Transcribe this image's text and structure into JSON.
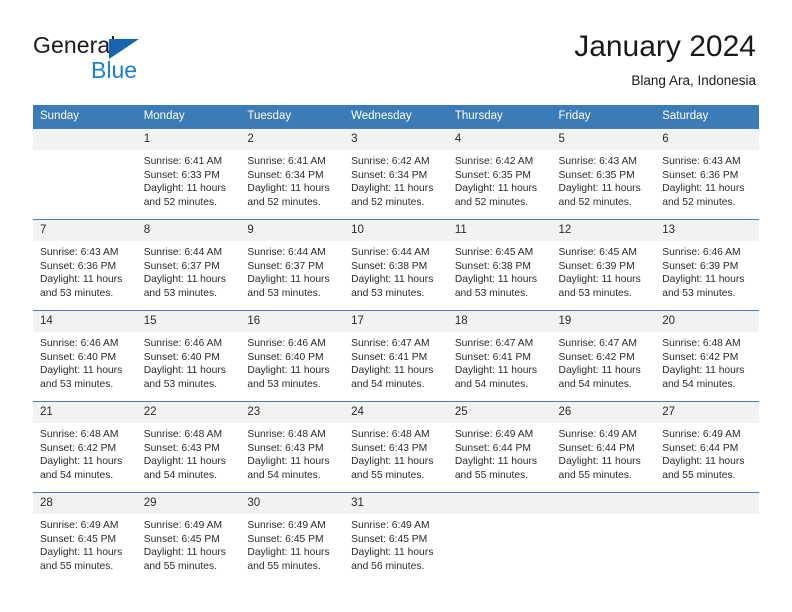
{
  "brand": {
    "name_part1": "General",
    "name_part2": "Blue",
    "accent_color": "#1a7fd4",
    "triangle_color": "#1565b0",
    "triangle_icon": "triangle-right-icon"
  },
  "header": {
    "title": "January 2024",
    "subtitle": "Blang Ara, Indonesia",
    "header_bg_color": "#3b7cb8"
  },
  "calendar": {
    "weekday_headers": [
      "Sunday",
      "Monday",
      "Tuesday",
      "Wednesday",
      "Thursday",
      "Friday",
      "Saturday"
    ],
    "labels": {
      "sunrise": "Sunrise:",
      "sunset": "Sunset:",
      "daylight": "Daylight:"
    },
    "weeks": [
      [
        {
          "day": "",
          "sunrise": "",
          "sunset": "",
          "daylight_line1": "",
          "daylight_line2": "",
          "empty": true
        },
        {
          "day": "1",
          "sunrise": "Sunrise: 6:41 AM",
          "sunset": "Sunset: 6:33 PM",
          "daylight_line1": "Daylight: 11 hours",
          "daylight_line2": "and 52 minutes.",
          "empty": false
        },
        {
          "day": "2",
          "sunrise": "Sunrise: 6:41 AM",
          "sunset": "Sunset: 6:34 PM",
          "daylight_line1": "Daylight: 11 hours",
          "daylight_line2": "and 52 minutes.",
          "empty": false
        },
        {
          "day": "3",
          "sunrise": "Sunrise: 6:42 AM",
          "sunset": "Sunset: 6:34 PM",
          "daylight_line1": "Daylight: 11 hours",
          "daylight_line2": "and 52 minutes.",
          "empty": false
        },
        {
          "day": "4",
          "sunrise": "Sunrise: 6:42 AM",
          "sunset": "Sunset: 6:35 PM",
          "daylight_line1": "Daylight: 11 hours",
          "daylight_line2": "and 52 minutes.",
          "empty": false
        },
        {
          "day": "5",
          "sunrise": "Sunrise: 6:43 AM",
          "sunset": "Sunset: 6:35 PM",
          "daylight_line1": "Daylight: 11 hours",
          "daylight_line2": "and 52 minutes.",
          "empty": false
        },
        {
          "day": "6",
          "sunrise": "Sunrise: 6:43 AM",
          "sunset": "Sunset: 6:36 PM",
          "daylight_line1": "Daylight: 11 hours",
          "daylight_line2": "and 52 minutes.",
          "empty": false
        }
      ],
      [
        {
          "day": "7",
          "sunrise": "Sunrise: 6:43 AM",
          "sunset": "Sunset: 6:36 PM",
          "daylight_line1": "Daylight: 11 hours",
          "daylight_line2": "and 53 minutes.",
          "empty": false
        },
        {
          "day": "8",
          "sunrise": "Sunrise: 6:44 AM",
          "sunset": "Sunset: 6:37 PM",
          "daylight_line1": "Daylight: 11 hours",
          "daylight_line2": "and 53 minutes.",
          "empty": false
        },
        {
          "day": "9",
          "sunrise": "Sunrise: 6:44 AM",
          "sunset": "Sunset: 6:37 PM",
          "daylight_line1": "Daylight: 11 hours",
          "daylight_line2": "and 53 minutes.",
          "empty": false
        },
        {
          "day": "10",
          "sunrise": "Sunrise: 6:44 AM",
          "sunset": "Sunset: 6:38 PM",
          "daylight_line1": "Daylight: 11 hours",
          "daylight_line2": "and 53 minutes.",
          "empty": false
        },
        {
          "day": "11",
          "sunrise": "Sunrise: 6:45 AM",
          "sunset": "Sunset: 6:38 PM",
          "daylight_line1": "Daylight: 11 hours",
          "daylight_line2": "and 53 minutes.",
          "empty": false
        },
        {
          "day": "12",
          "sunrise": "Sunrise: 6:45 AM",
          "sunset": "Sunset: 6:39 PM",
          "daylight_line1": "Daylight: 11 hours",
          "daylight_line2": "and 53 minutes.",
          "empty": false
        },
        {
          "day": "13",
          "sunrise": "Sunrise: 6:46 AM",
          "sunset": "Sunset: 6:39 PM",
          "daylight_line1": "Daylight: 11 hours",
          "daylight_line2": "and 53 minutes.",
          "empty": false
        }
      ],
      [
        {
          "day": "14",
          "sunrise": "Sunrise: 6:46 AM",
          "sunset": "Sunset: 6:40 PM",
          "daylight_line1": "Daylight: 11 hours",
          "daylight_line2": "and 53 minutes.",
          "empty": false
        },
        {
          "day": "15",
          "sunrise": "Sunrise: 6:46 AM",
          "sunset": "Sunset: 6:40 PM",
          "daylight_line1": "Daylight: 11 hours",
          "daylight_line2": "and 53 minutes.",
          "empty": false
        },
        {
          "day": "16",
          "sunrise": "Sunrise: 6:46 AM",
          "sunset": "Sunset: 6:40 PM",
          "daylight_line1": "Daylight: 11 hours",
          "daylight_line2": "and 53 minutes.",
          "empty": false
        },
        {
          "day": "17",
          "sunrise": "Sunrise: 6:47 AM",
          "sunset": "Sunset: 6:41 PM",
          "daylight_line1": "Daylight: 11 hours",
          "daylight_line2": "and 54 minutes.",
          "empty": false
        },
        {
          "day": "18",
          "sunrise": "Sunrise: 6:47 AM",
          "sunset": "Sunset: 6:41 PM",
          "daylight_line1": "Daylight: 11 hours",
          "daylight_line2": "and 54 minutes.",
          "empty": false
        },
        {
          "day": "19",
          "sunrise": "Sunrise: 6:47 AM",
          "sunset": "Sunset: 6:42 PM",
          "daylight_line1": "Daylight: 11 hours",
          "daylight_line2": "and 54 minutes.",
          "empty": false
        },
        {
          "day": "20",
          "sunrise": "Sunrise: 6:48 AM",
          "sunset": "Sunset: 6:42 PM",
          "daylight_line1": "Daylight: 11 hours",
          "daylight_line2": "and 54 minutes.",
          "empty": false
        }
      ],
      [
        {
          "day": "21",
          "sunrise": "Sunrise: 6:48 AM",
          "sunset": "Sunset: 6:42 PM",
          "daylight_line1": "Daylight: 11 hours",
          "daylight_line2": "and 54 minutes.",
          "empty": false
        },
        {
          "day": "22",
          "sunrise": "Sunrise: 6:48 AM",
          "sunset": "Sunset: 6:43 PM",
          "daylight_line1": "Daylight: 11 hours",
          "daylight_line2": "and 54 minutes.",
          "empty": false
        },
        {
          "day": "23",
          "sunrise": "Sunrise: 6:48 AM",
          "sunset": "Sunset: 6:43 PM",
          "daylight_line1": "Daylight: 11 hours",
          "daylight_line2": "and 54 minutes.",
          "empty": false
        },
        {
          "day": "24",
          "sunrise": "Sunrise: 6:48 AM",
          "sunset": "Sunset: 6:43 PM",
          "daylight_line1": "Daylight: 11 hours",
          "daylight_line2": "and 55 minutes.",
          "empty": false
        },
        {
          "day": "25",
          "sunrise": "Sunrise: 6:49 AM",
          "sunset": "Sunset: 6:44 PM",
          "daylight_line1": "Daylight: 11 hours",
          "daylight_line2": "and 55 minutes.",
          "empty": false
        },
        {
          "day": "26",
          "sunrise": "Sunrise: 6:49 AM",
          "sunset": "Sunset: 6:44 PM",
          "daylight_line1": "Daylight: 11 hours",
          "daylight_line2": "and 55 minutes.",
          "empty": false
        },
        {
          "day": "27",
          "sunrise": "Sunrise: 6:49 AM",
          "sunset": "Sunset: 6:44 PM",
          "daylight_line1": "Daylight: 11 hours",
          "daylight_line2": "and 55 minutes.",
          "empty": false
        }
      ],
      [
        {
          "day": "28",
          "sunrise": "Sunrise: 6:49 AM",
          "sunset": "Sunset: 6:45 PM",
          "daylight_line1": "Daylight: 11 hours",
          "daylight_line2": "and 55 minutes.",
          "empty": false
        },
        {
          "day": "29",
          "sunrise": "Sunrise: 6:49 AM",
          "sunset": "Sunset: 6:45 PM",
          "daylight_line1": "Daylight: 11 hours",
          "daylight_line2": "and 55 minutes.",
          "empty": false
        },
        {
          "day": "30",
          "sunrise": "Sunrise: 6:49 AM",
          "sunset": "Sunset: 6:45 PM",
          "daylight_line1": "Daylight: 11 hours",
          "daylight_line2": "and 55 minutes.",
          "empty": false
        },
        {
          "day": "31",
          "sunrise": "Sunrise: 6:49 AM",
          "sunset": "Sunset: 6:45 PM",
          "daylight_line1": "Daylight: 11 hours",
          "daylight_line2": "and 56 minutes.",
          "empty": false
        },
        {
          "day": "",
          "sunrise": "",
          "sunset": "",
          "daylight_line1": "",
          "daylight_line2": "",
          "empty": true
        },
        {
          "day": "",
          "sunrise": "",
          "sunset": "",
          "daylight_line1": "",
          "daylight_line2": "",
          "empty": true
        },
        {
          "day": "",
          "sunrise": "",
          "sunset": "",
          "daylight_line1": "",
          "daylight_line2": "",
          "empty": true
        }
      ]
    ]
  }
}
